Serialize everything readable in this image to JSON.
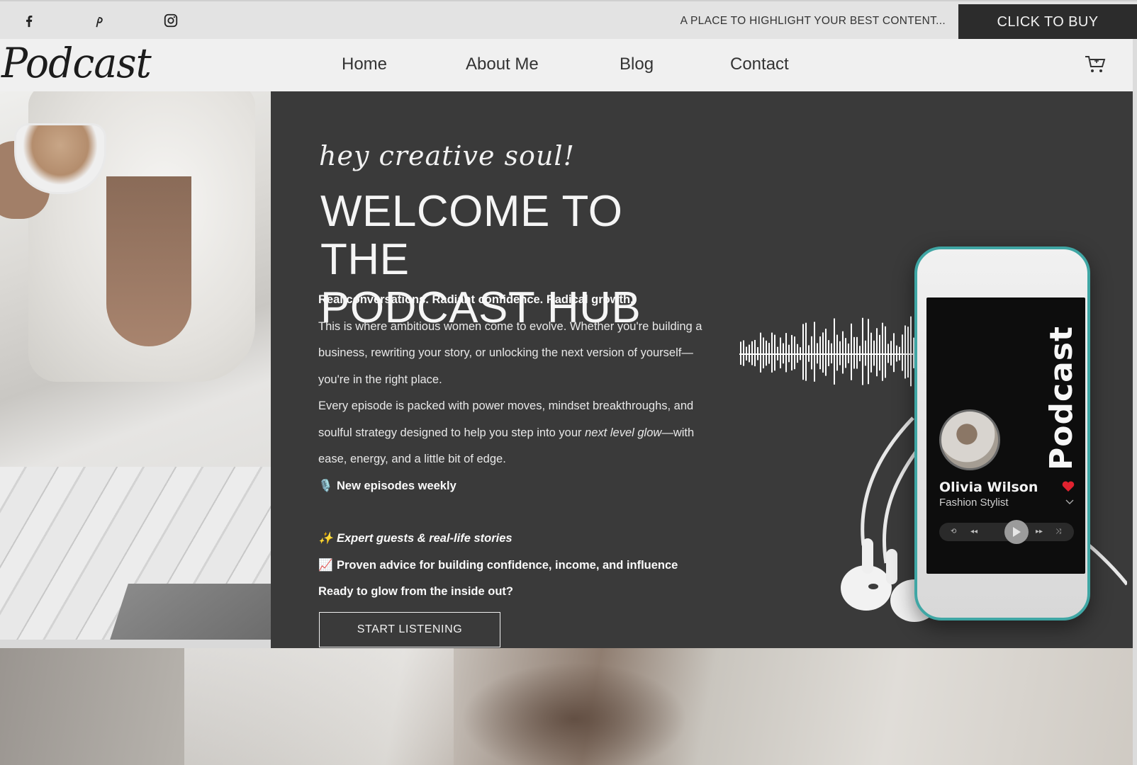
{
  "topbar": {
    "social_icons": [
      "facebook-icon",
      "pinterest-icon",
      "instagram-icon"
    ],
    "promo_text": "A PLACE TO HIGHLIGHT YOUR BEST CONTENT...",
    "buy_button": "CLICK TO BUY"
  },
  "nav": {
    "logo": "Podcast",
    "links": [
      "Home",
      "About Me",
      "Blog",
      "Contact"
    ],
    "cart_icon": "cart-icon"
  },
  "hero": {
    "script_heading": "hey creative soul!",
    "headline_line1": "WELCOME TO THE",
    "headline_line2": "PODCAST HUB",
    "tagline": "Real conversations. Radiant confidence. Radical growth.",
    "paragraph1": "This is where ambitious women come to evolve. Whether you're building a business, rewriting your story, or unlocking the next version of yourself—you're in the right place.",
    "paragraph2_pre": "Every episode is packed with power moves, mindset breakthroughs, and soulful strategy designed to help you step into your ",
    "paragraph2_italic": "next level glow",
    "paragraph2_post": "—with ease, energy, and a little bit of edge.",
    "feature1_emoji": "🎙️",
    "feature1": "New episodes weekly",
    "feature2_emoji": "✨",
    "feature2": "Expert guests & real-life stories",
    "feature3_emoji": "📈",
    "feature3": "Proven advice for building confidence, income, and influence",
    "closing": "Ready to glow from the inside out?",
    "cta": "START LISTENING"
  },
  "phone": {
    "screen_title": "Podcast",
    "host_name": "Olivia Wilson",
    "host_role": "Fashion Stylist"
  },
  "colors": {
    "hero_bg": "#3a3a3a",
    "topbar_bg": "#e3e3e3",
    "button_dark": "#2c2c2c",
    "phone_accent": "#3fa6a4",
    "heart": "#e0222f"
  }
}
